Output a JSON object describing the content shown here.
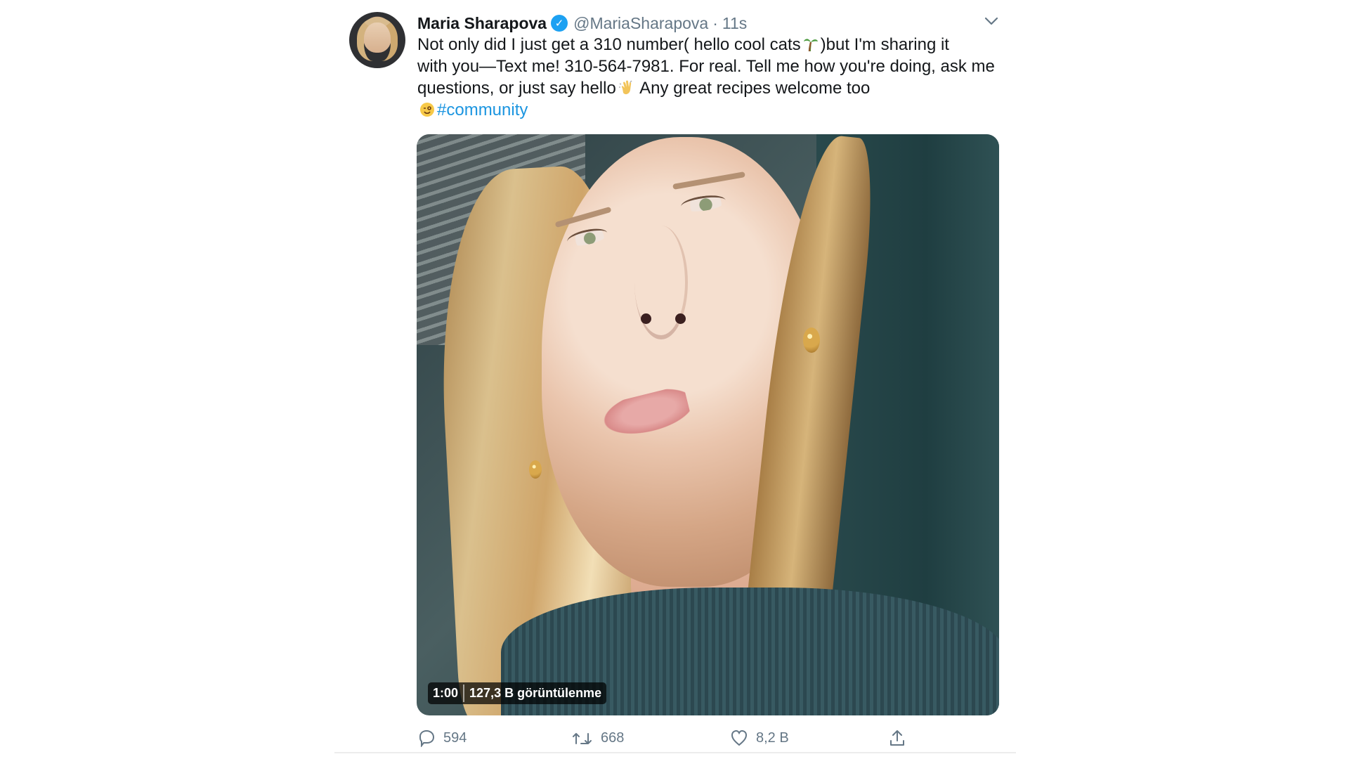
{
  "tweet": {
    "display_name": "Maria Sharapova",
    "verified_icon": "verified-check-icon",
    "handle": "@MariaSharapova",
    "separator": "·",
    "time": "11s",
    "text_lines": [
      "Not only did I just get a 310 number( hello cool cats",
      ")but I'm sharing it",
      "with you—Text me! 310-564-7981. For real. Tell me how you're doing, ask me",
      "questions, or just say hello",
      " Any great recipes welcome too",
      "#community"
    ],
    "emojis": [
      "palm-tree-emoji",
      "waving-hand-emoji",
      "winking-face-emoji"
    ],
    "media": {
      "duration": "1:00",
      "views": "127,3 B görüntülenme"
    },
    "actions": {
      "reply_count": "594",
      "retweet_count": "668",
      "like_count": "8,2 B"
    }
  },
  "colors": {
    "accent": "#1da1f2",
    "hashtag": "#1b95e0",
    "muted": "#657786",
    "text": "#14171a"
  }
}
